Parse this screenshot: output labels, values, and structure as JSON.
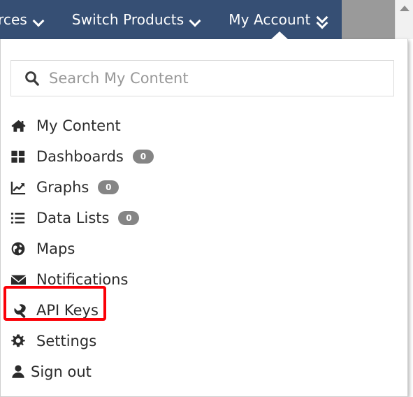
{
  "navbar": {
    "background_color": "#364f74",
    "items": [
      {
        "label": "rces",
        "icon": "chevron-down-icon",
        "name": "resources"
      },
      {
        "label": "Switch Products",
        "icon": "chevron-down-icon",
        "name": "switch-products"
      },
      {
        "label": "My Account",
        "icon": "double-chevron-down-icon",
        "name": "my-account"
      }
    ]
  },
  "scrollbar": {
    "up_arrow_icon": "triangle-up-icon"
  },
  "dropdown": {
    "search": {
      "icon": "search-icon",
      "placeholder": "Search My Content",
      "value": ""
    },
    "items": [
      {
        "label": "My Content",
        "icon": "home-icon",
        "badge": null,
        "name": "my-content"
      },
      {
        "label": "Dashboards",
        "icon": "grid-icon",
        "badge": "0",
        "name": "dashboards"
      },
      {
        "label": "Graphs",
        "icon": "line-chart-icon",
        "badge": "0",
        "name": "graphs"
      },
      {
        "label": "Data Lists",
        "icon": "list-icon",
        "badge": "0",
        "name": "data-lists"
      },
      {
        "label": "Maps",
        "icon": "globe-icon",
        "badge": null,
        "name": "maps"
      },
      {
        "label": "Notifications",
        "icon": "envelope-icon",
        "badge": null,
        "name": "notifications"
      },
      {
        "label": "API Keys",
        "icon": "wrench-icon",
        "badge": null,
        "name": "api-keys"
      },
      {
        "label": "Settings",
        "icon": "gear-icon",
        "badge": null,
        "name": "settings"
      },
      {
        "label": "Sign out",
        "icon": "user-icon",
        "badge": null,
        "name": "sign-out"
      }
    ]
  },
  "highlight": {
    "target": "API Keys",
    "color": "#fb0007"
  }
}
